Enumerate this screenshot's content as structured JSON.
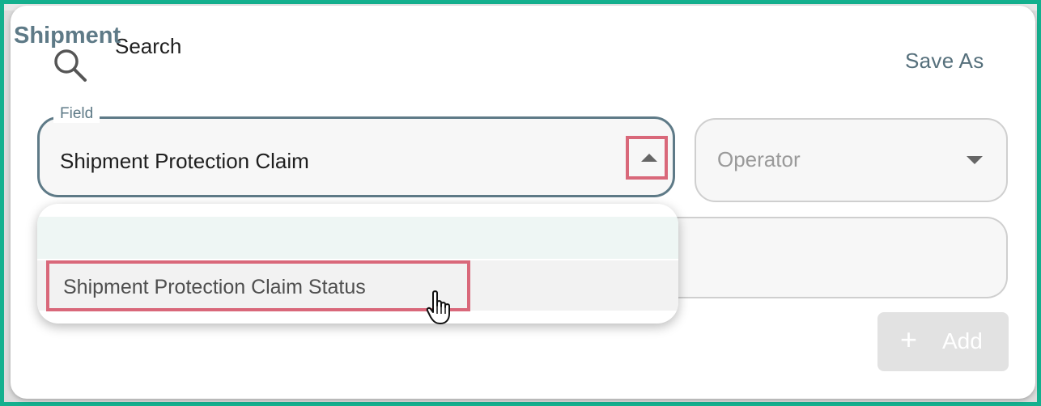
{
  "header": {
    "title": "Search",
    "save_as_label": "Save As"
  },
  "field": {
    "label": "Field",
    "value": "Shipment Protection Claim",
    "arrow_icon": "caret-up-icon"
  },
  "operator": {
    "placeholder": "Operator",
    "arrow_icon": "caret-down-icon"
  },
  "add_button": {
    "icon": "plus-icon",
    "label": "Add"
  },
  "dropdown": {
    "group_label": "Shipment",
    "options": [
      {
        "label": "Shipment Protection Claim Status"
      }
    ]
  },
  "colors": {
    "frame": "#14b08e",
    "accent": "#5e7a87",
    "highlight": "#d9687a",
    "group_bg": "#eef6f4"
  }
}
